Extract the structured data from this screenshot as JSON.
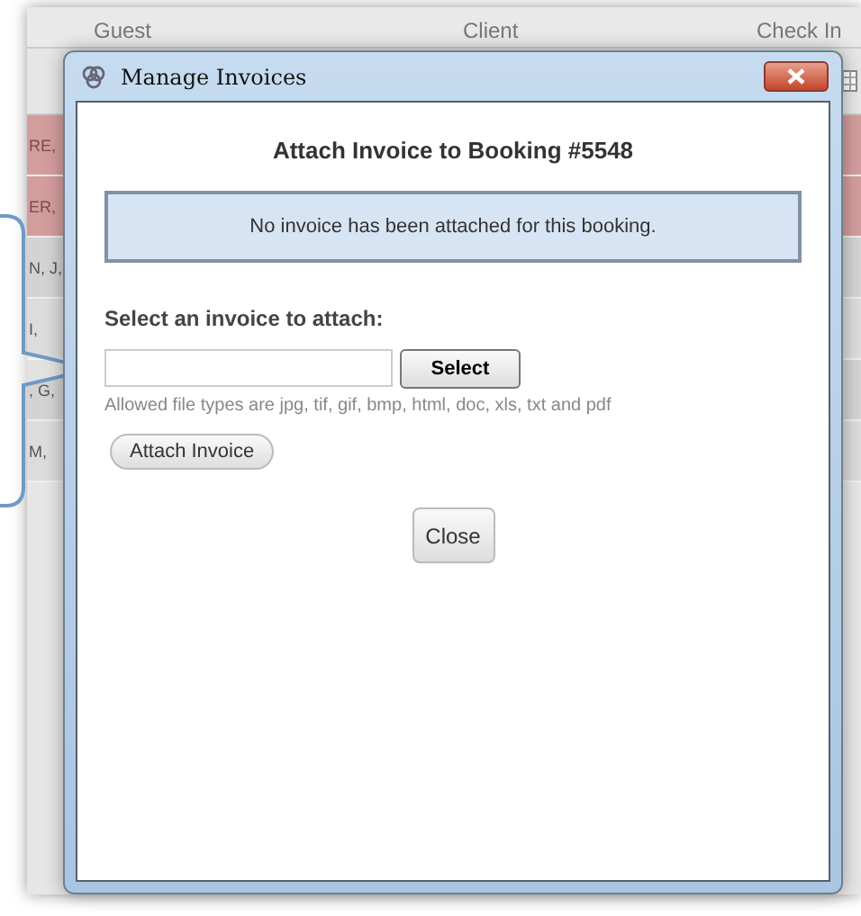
{
  "background_table": {
    "columns": [
      "Guest",
      "Client",
      "Check In"
    ],
    "rows": [
      {
        "guest": "RE,",
        "flagged": true
      },
      {
        "guest": "ER,",
        "flagged": true
      },
      {
        "guest": "N, J,",
        "flagged": false
      },
      {
        "guest": "I,",
        "flagged": false
      },
      {
        "guest": ", G,",
        "flagged": false
      },
      {
        "guest": "M,",
        "flagged": false
      }
    ]
  },
  "dialog": {
    "title": "Manage Invoices",
    "heading": "Attach Invoice to Booking #5548",
    "notice": "No invoice has been attached for this booking.",
    "select_label": "Select an invoice to attach:",
    "select_button": "Select",
    "help_text": "Allowed file types are jpg, tif, gif, bmp, html, doc, xls, txt and pdf",
    "attach_button": "Attach Invoice",
    "close_button": "Close"
  }
}
